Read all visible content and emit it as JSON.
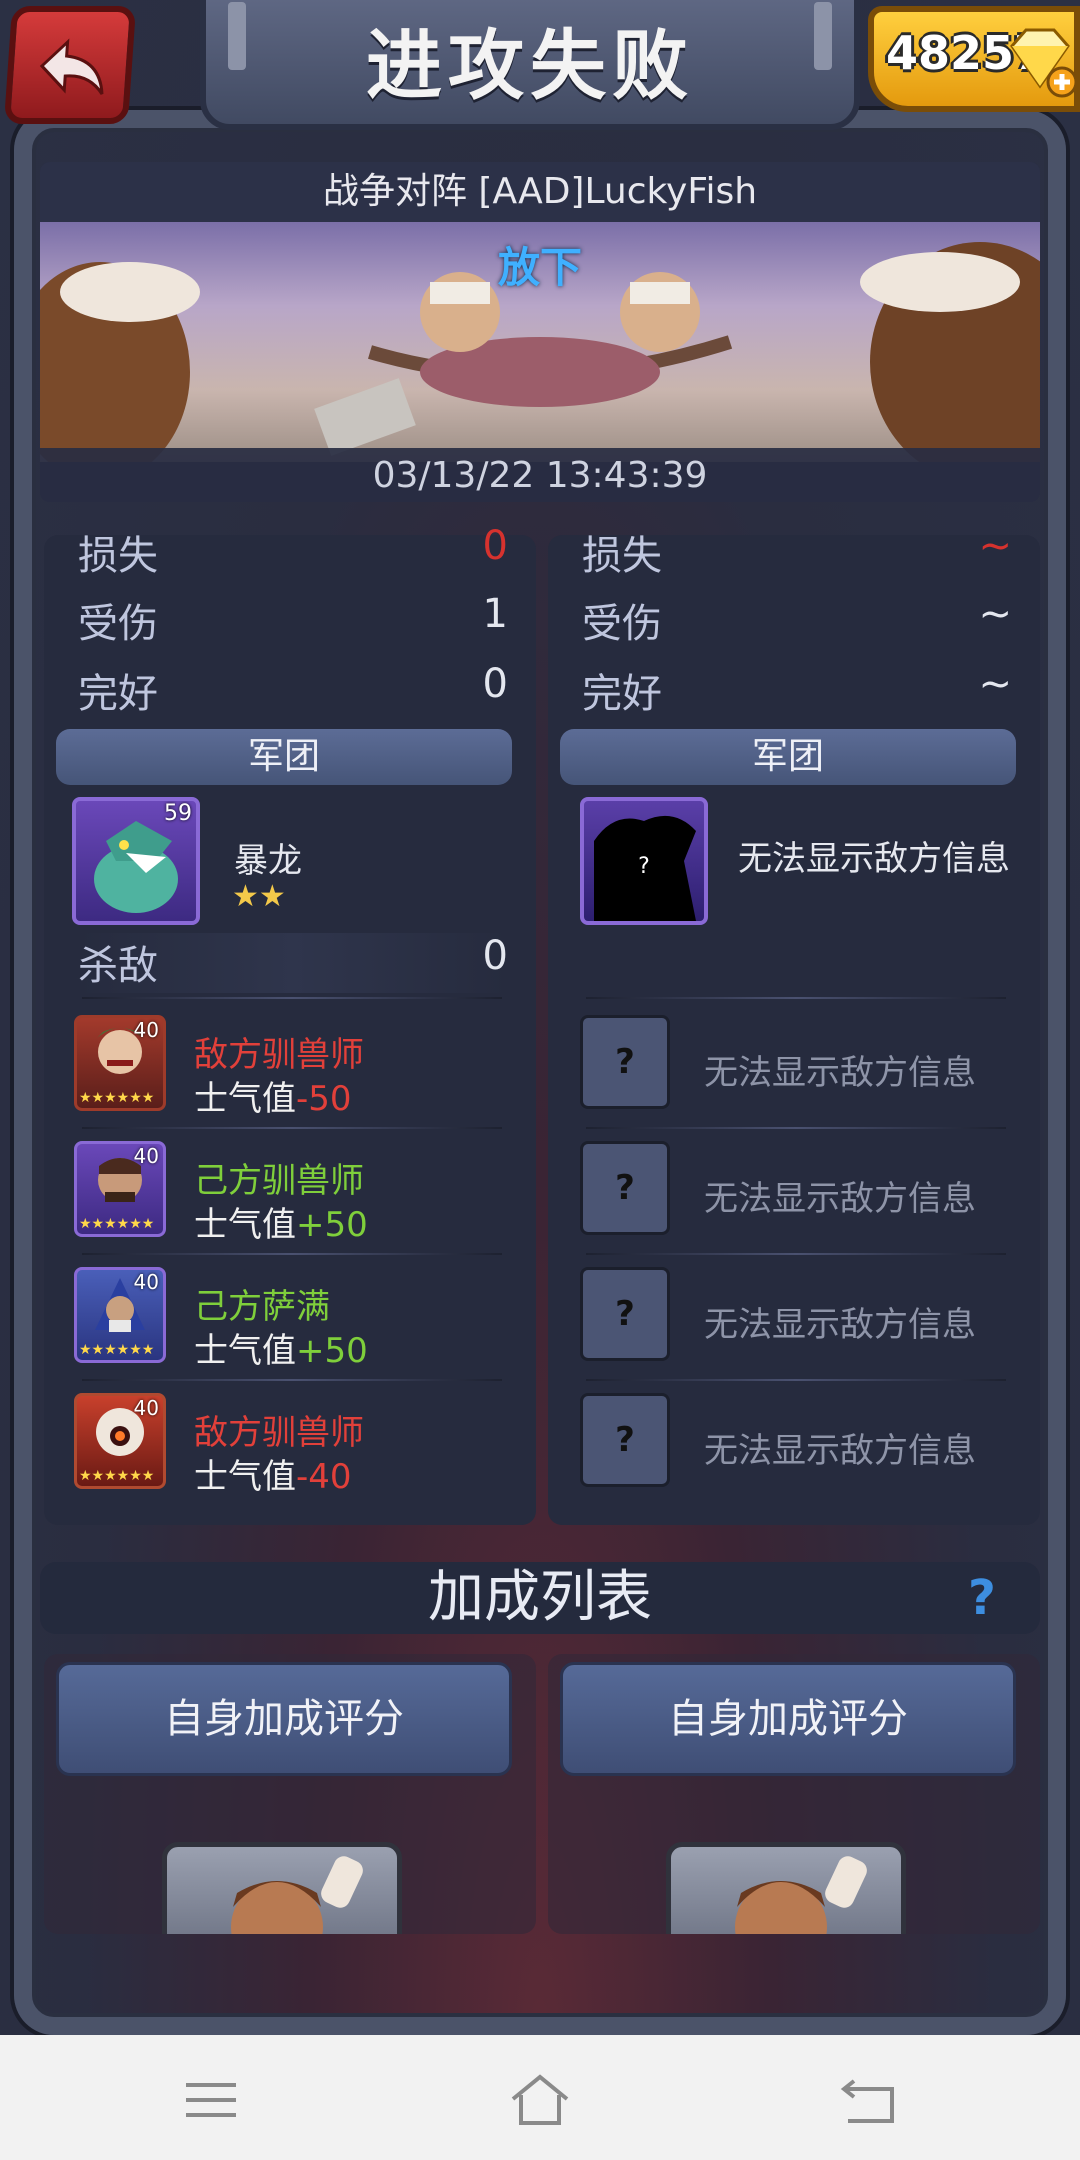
{
  "header": {
    "back_icon": "back-arrow-icon",
    "title": "进攻失败",
    "gems": "48257",
    "gem_icon": "diamond-plus-icon"
  },
  "battle": {
    "opponent": "战争对阵 [AAD]LuckyFish",
    "label": "放下",
    "timestamp": "03/13/22 13:43:39"
  },
  "left_panel": {
    "stats": [
      {
        "label": "损失",
        "value": "0"
      },
      {
        "label": "受伤",
        "value": "1"
      },
      {
        "label": "完好",
        "value": "0"
      }
    ],
    "legion_header": "军团",
    "unit": {
      "name": "暴龙",
      "level": "59",
      "stars": "★★"
    },
    "kills_label": "杀敌",
    "kills_value": "0",
    "log": [
      {
        "level": "40",
        "name": "敌方驯兽师",
        "morale_label": "士气值",
        "morale": "-50",
        "side": "enemy"
      },
      {
        "level": "40",
        "name": "己方驯兽师",
        "morale_label": "士气值",
        "morale": "+50",
        "side": "ally"
      },
      {
        "level": "40",
        "name": "己方萨满",
        "morale_label": "士气值",
        "morale": "+50",
        "side": "ally"
      },
      {
        "level": "40",
        "name": "敌方驯兽师",
        "morale_label": "士气值",
        "morale": "-40",
        "side": "enemy"
      }
    ],
    "log_stars": "★★★★★★"
  },
  "right_panel": {
    "stats": [
      {
        "label": "损失",
        "value": "~"
      },
      {
        "label": "受伤",
        "value": "~"
      },
      {
        "label": "完好",
        "value": "~"
      }
    ],
    "legion_header": "军团",
    "unknown_text": "无法显示敌方信息",
    "unknown_mark": "?",
    "log": [
      {
        "mark": "?",
        "text": "无法显示敌方信息"
      },
      {
        "mark": "?",
        "text": "无法显示敌方信息"
      },
      {
        "mark": "?",
        "text": "无法显示敌方信息"
      },
      {
        "mark": "?",
        "text": "无法显示敌方信息"
      }
    ]
  },
  "bonus": {
    "title": "加成列表",
    "help": "?",
    "left_button": "自身加成评分",
    "right_button": "自身加成评分"
  },
  "navbar": {
    "menu_icon": "menu-icon",
    "home_icon": "home-icon",
    "back_icon": "back-nav-icon"
  },
  "colors": {
    "enemy": "#e2403a",
    "ally": "#7fcf3b",
    "accent_blue": "#3fb0ff",
    "gold": "#ffcf3e"
  }
}
